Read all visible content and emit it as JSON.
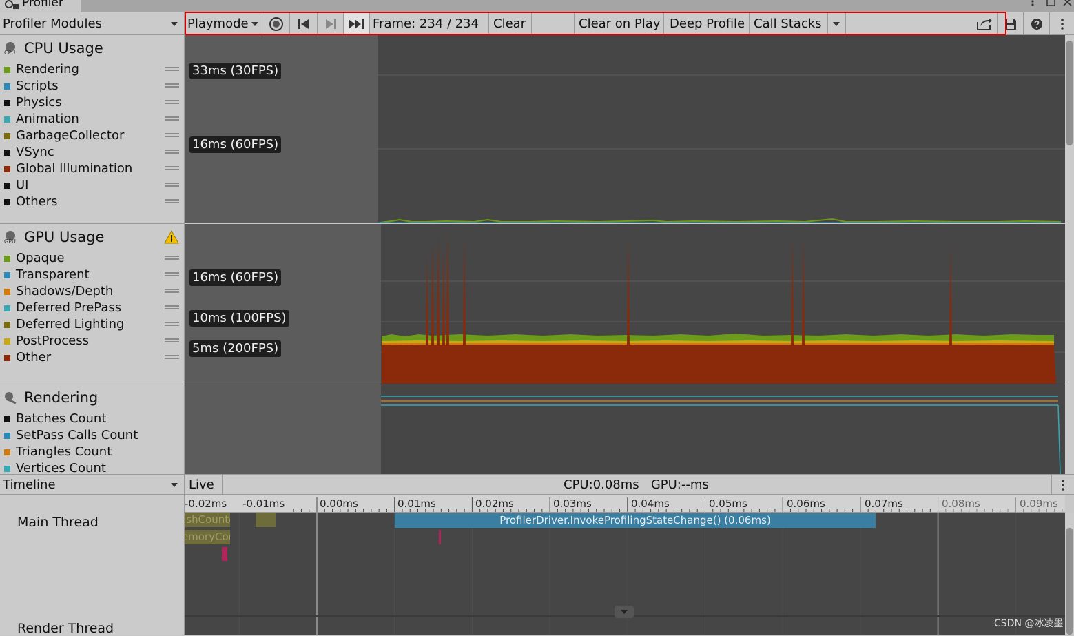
{
  "window": {
    "tab_title": "Profiler"
  },
  "toolbar": {
    "modules_dropdown": "Profiler Modules",
    "mode_dropdown": "Playmode",
    "frame_label": "Frame: 234 / 234",
    "clear": "Clear",
    "clear_on_play": "Clear on Play",
    "deep_profile": "Deep Profile",
    "call_stacks": "Call Stacks"
  },
  "cpu": {
    "title": "CPU Usage",
    "legend": [
      {
        "label": "Rendering",
        "color": "#6c9a1a"
      },
      {
        "label": "Scripts",
        "color": "#2b8ab8"
      },
      {
        "label": "Physics",
        "color": "#111111"
      },
      {
        "label": "Animation",
        "color": "#3aa7b5"
      },
      {
        "label": "GarbageCollector",
        "color": "#7a6a10"
      },
      {
        "label": "VSync",
        "color": "#111111"
      },
      {
        "label": "Global Illumination",
        "color": "#8a2a0a"
      },
      {
        "label": "UI",
        "color": "#111111"
      },
      {
        "label": "Others",
        "color": "#111111"
      }
    ],
    "labels": [
      "33ms (30FPS)",
      "16ms (60FPS)"
    ]
  },
  "gpu": {
    "title": "GPU Usage",
    "legend": [
      {
        "label": "Opaque",
        "color": "#6c9a1a"
      },
      {
        "label": "Transparent",
        "color": "#2b8ab8"
      },
      {
        "label": "Shadows/Depth",
        "color": "#d07a10"
      },
      {
        "label": "Deferred PrePass",
        "color": "#3aa7b5"
      },
      {
        "label": "Deferred Lighting",
        "color": "#7a6a10"
      },
      {
        "label": "PostProcess",
        "color": "#c9a818"
      },
      {
        "label": "Other",
        "color": "#8a2a0a"
      }
    ],
    "labels": [
      "16ms (60FPS)",
      "10ms (100FPS)",
      "5ms (200FPS)"
    ]
  },
  "rendering": {
    "title": "Rendering",
    "legend": [
      {
        "label": "Batches Count",
        "color": "#111111"
      },
      {
        "label": "SetPass Calls Count",
        "color": "#2b8ab8"
      },
      {
        "label": "Triangles Count",
        "color": "#d07a10"
      },
      {
        "label": "Vertices Count",
        "color": "#3aa7b5"
      }
    ]
  },
  "timeline": {
    "view_dropdown": "Timeline",
    "live_button": "Live",
    "stats": "CPU:0.08ms   GPU:--ms",
    "ticks": [
      "-0.02ms",
      "-0.01ms",
      "0.00ms",
      "0.01ms",
      "0.02ms",
      "0.03ms",
      "0.04ms",
      "0.05ms",
      "0.06ms",
      "0.07ms",
      "0.08ms",
      "0.09ms"
    ],
    "threads": [
      "Main Thread",
      "Render Thread"
    ],
    "marker": "ProfilerDriver.InvokeProfilingStateChange() (0.06ms)",
    "left_marker_1": "FlushCounters",
    "left_marker_2": "MemoryCounters"
  },
  "watermark": "CSDN @冰凌墨",
  "colors": {
    "chart_bg": "#464646",
    "chart_bg_left": "#5c5c5c",
    "highlight": "#d80000",
    "marker": "#3a7ea1"
  }
}
